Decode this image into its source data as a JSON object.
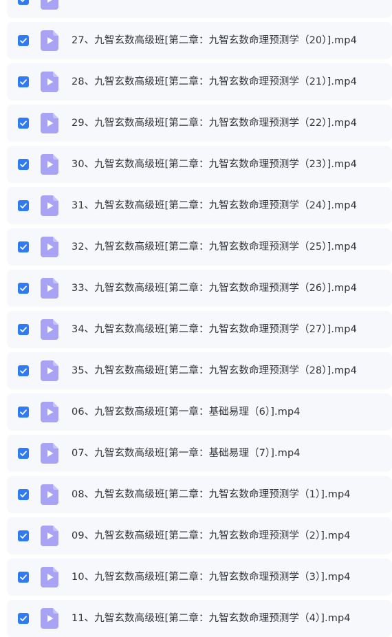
{
  "colors": {
    "checkbox": "#2f7bf6",
    "file_icon": "#a9a3f5",
    "row_background": "#f7f8fc",
    "text": "#30333a"
  },
  "icons": {
    "checkbox": "checkbox-checked-icon",
    "file": "video-file-play-icon"
  },
  "files": [
    {
      "name": "",
      "checked": true
    },
    {
      "name": "27、九智玄数高级班[第二章：九智玄数命理预测学（20）].mp4",
      "checked": true
    },
    {
      "name": "28、九智玄数高级班[第二章：九智玄数命理预测学（21）].mp4",
      "checked": true
    },
    {
      "name": "29、九智玄数高级班[第二章：九智玄数命理预测学（22）].mp4",
      "checked": true
    },
    {
      "name": "30、九智玄数高级班[第二章：九智玄数命理预测学（23）].mp4",
      "checked": true
    },
    {
      "name": "31、九智玄数高级班[第二章：九智玄数命理预测学（24）].mp4",
      "checked": true
    },
    {
      "name": "32、九智玄数高级班[第二章：九智玄数命理预测学（25）].mp4",
      "checked": true
    },
    {
      "name": "33、九智玄数高级班[第二章：九智玄数命理预测学（26）].mp4",
      "checked": true
    },
    {
      "name": "34、九智玄数高级班[第二章：九智玄数命理预测学（27）].mp4",
      "checked": true
    },
    {
      "name": "35、九智玄数高级班[第二章：九智玄数命理预测学（28）].mp4",
      "checked": true
    },
    {
      "name": "06、九智玄数高级班[第一章：基础易理（6）].mp4",
      "checked": true,
      "glitch": true
    },
    {
      "name": "07、九智玄数高级班[第一章：基础易理（7）].mp4",
      "checked": true
    },
    {
      "name": "08、九智玄数高级班[第二章：九智玄数命理预测学（1）].mp4",
      "checked": true
    },
    {
      "name": "09、九智玄数高级班[第二章：九智玄数命理预测学（2）].mp4",
      "checked": true
    },
    {
      "name": "10、九智玄数高级班[第二章：九智玄数命理预测学（3）].mp4",
      "checked": true
    },
    {
      "name": "11、九智玄数高级班[第二章：九智玄数命理预测学（4）].mp4",
      "checked": true
    }
  ]
}
